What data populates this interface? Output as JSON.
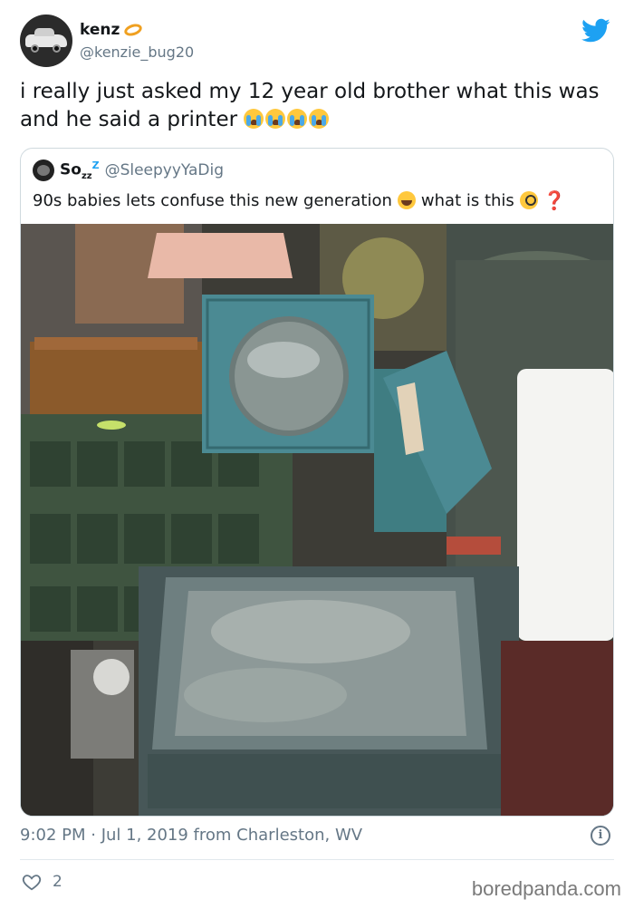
{
  "author": {
    "display_name": "kenz",
    "handle": "@kenzie_bug20"
  },
  "tweet": {
    "text": "i really just asked my 12 year old brother what this was and he said a printer"
  },
  "quoted_tweet": {
    "display_name": "So",
    "name_suffix_sub": "z",
    "name_suffix_sub2": "z",
    "name_suffix_sup": "Z",
    "handle": "@SleepyyYaDig",
    "text": "90s babies lets confuse this new generation",
    "text_after_emoji": "what is this",
    "question_mark": "❓"
  },
  "meta": {
    "timestamp": "9:02 PM · Jul 1, 2019 from Charleston, WV",
    "info_label": "i"
  },
  "engagement": {
    "likes": "2"
  },
  "watermark": "boredpanda.com",
  "colors": {
    "twitter_blue": "#1da1f2",
    "secondary_text": "#657786",
    "projector_teal": "#4b8a93"
  }
}
